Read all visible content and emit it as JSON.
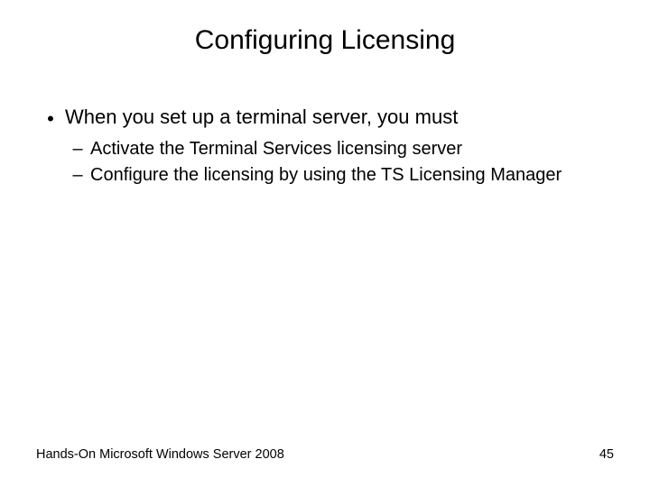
{
  "title": "Configuring Licensing",
  "bullets": [
    {
      "marker": "•",
      "text": "When you set up a terminal server, you must",
      "sub": [
        {
          "marker": "–",
          "text": "Activate the Terminal Services licensing server"
        },
        {
          "marker": "–",
          "text": "Configure the licensing by using the TS Licensing Manager"
        }
      ]
    }
  ],
  "footer": {
    "left": "Hands-On Microsoft Windows Server 2008",
    "right": "45"
  }
}
